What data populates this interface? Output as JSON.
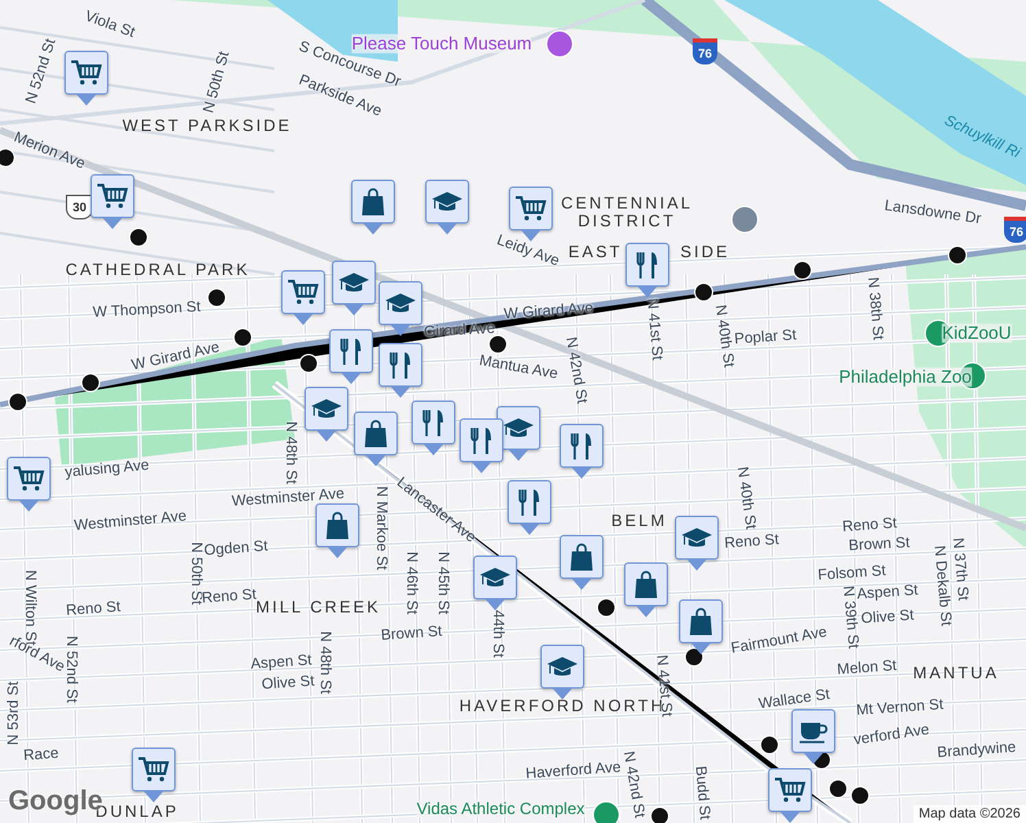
{
  "map": {
    "labels": [
      {
        "text": "Viola St",
        "kind": "street"
      },
      {
        "text": "N 52nd St",
        "kind": "street"
      },
      {
        "text": "S Concourse Dr",
        "kind": "street"
      },
      {
        "text": "Parkside Ave",
        "kind": "street"
      },
      {
        "text": "N 50th St",
        "kind": "street"
      },
      {
        "text": "WEST PARKSIDE",
        "kind": "area"
      },
      {
        "text": "Merion Ave",
        "kind": "street"
      },
      {
        "text": "CENTENNIAL DISTRICT",
        "kind": "area"
      },
      {
        "text": "Lansdowne Dr",
        "kind": "street"
      },
      {
        "text": "Schuylkill Ri",
        "kind": "water"
      },
      {
        "text": "EAST",
        "kind": "area"
      },
      {
        "text": "SIDE",
        "kind": "area"
      },
      {
        "text": "CATHEDRAL PARK",
        "kind": "area"
      },
      {
        "text": "W Thompson St",
        "kind": "street"
      },
      {
        "text": "W Girard Ave",
        "kind": "street"
      },
      {
        "text": "Girard Ave",
        "kind": "street"
      },
      {
        "text": "W Girard Ave",
        "kind": "street"
      },
      {
        "text": "Leidy Ave",
        "kind": "street"
      },
      {
        "text": "Mantua Ave",
        "kind": "street"
      },
      {
        "text": "N 42nd St",
        "kind": "street"
      },
      {
        "text": "N 41st St",
        "kind": "street"
      },
      {
        "text": "N 40th St",
        "kind": "street"
      },
      {
        "text": "Poplar St",
        "kind": "street"
      },
      {
        "text": "N 38th St",
        "kind": "street"
      },
      {
        "text": "KidZooU",
        "kind": "zoo"
      },
      {
        "text": "Philadelphia Zoo",
        "kind": "zoo"
      },
      {
        "text": "Please Touch Museum",
        "kind": "museum"
      },
      {
        "text": "N 48th St",
        "kind": "street"
      },
      {
        "text": "yalusing Ave",
        "kind": "street"
      },
      {
        "text": "Westminster Ave",
        "kind": "street"
      },
      {
        "text": "Westminster Ave",
        "kind": "street"
      },
      {
        "text": "Lancaster Ave",
        "kind": "street"
      },
      {
        "text": "N Markoe St",
        "kind": "street"
      },
      {
        "text": "N 46th St",
        "kind": "street"
      },
      {
        "text": "N 45th St",
        "kind": "street"
      },
      {
        "text": "BELM",
        "kind": "area"
      },
      {
        "text": "N 40th St",
        "kind": "street"
      },
      {
        "text": "Reno St",
        "kind": "street"
      },
      {
        "text": "Reno St",
        "kind": "street"
      },
      {
        "text": "Brown St",
        "kind": "street"
      },
      {
        "text": "Ogden St",
        "kind": "street"
      },
      {
        "text": "N 50th St",
        "kind": "street"
      },
      {
        "text": "Reno St",
        "kind": "street"
      },
      {
        "text": "Reno St",
        "kind": "street"
      },
      {
        "text": "MILL CREEK",
        "kind": "area"
      },
      {
        "text": "Brown St",
        "kind": "street"
      },
      {
        "text": "44th St",
        "kind": "street"
      },
      {
        "text": "N Wilton St",
        "kind": "street"
      },
      {
        "text": "rford Ave",
        "kind": "street"
      },
      {
        "text": "N 52nd St",
        "kind": "street"
      },
      {
        "text": "N 53rd St",
        "kind": "street"
      },
      {
        "text": "Aspen St",
        "kind": "street"
      },
      {
        "text": "Olive St",
        "kind": "street"
      },
      {
        "text": "N 48th St",
        "kind": "street"
      },
      {
        "text": "Race",
        "kind": "street"
      },
      {
        "text": "HAVERFORD NORTH",
        "kind": "area"
      },
      {
        "text": "Folsom St",
        "kind": "street"
      },
      {
        "text": "Aspen St",
        "kind": "street"
      },
      {
        "text": "Olive St",
        "kind": "street"
      },
      {
        "text": "N 39th St",
        "kind": "street"
      },
      {
        "text": "N Dekalb St",
        "kind": "street"
      },
      {
        "text": "N 37th St",
        "kind": "street"
      },
      {
        "text": "Fairmount Ave",
        "kind": "street"
      },
      {
        "text": "Melon St",
        "kind": "street"
      },
      {
        "text": "MANTUA",
        "kind": "area"
      },
      {
        "text": "Wallace St",
        "kind": "street"
      },
      {
        "text": "Mt Vernon St",
        "kind": "street"
      },
      {
        "text": "verford Ave",
        "kind": "street"
      },
      {
        "text": "Brandywine",
        "kind": "street"
      },
      {
        "text": "Haverford Ave",
        "kind": "street"
      },
      {
        "text": "N 41st St",
        "kind": "street"
      },
      {
        "text": "N 42nd St",
        "kind": "street"
      },
      {
        "text": "Budd St",
        "kind": "street"
      },
      {
        "text": "DUNLAP",
        "kind": "area"
      },
      {
        "text": "Vidas Athletic Complex",
        "kind": "park"
      }
    ],
    "shields": [
      {
        "text": "76",
        "kind": "interstate"
      },
      {
        "text": "76",
        "kind": "interstate"
      },
      {
        "text": "30",
        "kind": "us"
      }
    ],
    "markers": [
      {
        "kind": "grocery"
      },
      {
        "kind": "grocery"
      },
      {
        "kind": "grocery"
      },
      {
        "kind": "grocery"
      },
      {
        "kind": "grocery"
      },
      {
        "kind": "grocery"
      },
      {
        "kind": "grocery"
      },
      {
        "kind": "shopping"
      },
      {
        "kind": "shopping"
      },
      {
        "kind": "shopping"
      },
      {
        "kind": "shopping"
      },
      {
        "kind": "shopping"
      },
      {
        "kind": "shopping"
      },
      {
        "kind": "school"
      },
      {
        "kind": "school"
      },
      {
        "kind": "school"
      },
      {
        "kind": "school"
      },
      {
        "kind": "school"
      },
      {
        "kind": "school"
      },
      {
        "kind": "school"
      },
      {
        "kind": "school"
      },
      {
        "kind": "restaurant"
      },
      {
        "kind": "restaurant"
      },
      {
        "kind": "restaurant"
      },
      {
        "kind": "restaurant"
      },
      {
        "kind": "restaurant"
      },
      {
        "kind": "restaurant"
      },
      {
        "kind": "restaurant"
      },
      {
        "kind": "cafe"
      }
    ],
    "logo": "Google",
    "attribution": "Map data ©2026"
  }
}
